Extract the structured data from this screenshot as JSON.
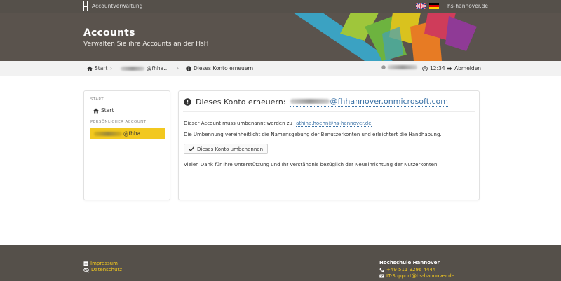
{
  "topbar": {
    "app_title": "Accountverwaltung",
    "domain": "hs-hannover.de",
    "languages": [
      {
        "code": "en",
        "icon": "uk-flag-icon"
      },
      {
        "code": "de",
        "icon": "germany-flag-icon"
      }
    ]
  },
  "hero": {
    "title": "Accounts",
    "subtitle": "Verwalten Sie ihre Accounts an der HsH"
  },
  "breadcrumb": {
    "start": "Start",
    "account_suffix": "@fhha…",
    "current": "Dieses Konto erneuern",
    "time": "12:34",
    "logout": "Abmelden"
  },
  "sidebar": {
    "section_start": "START",
    "start_label": "Start",
    "section_account": "PERSÖNLICHER ACCOUNT",
    "account_suffix": "@fhha…"
  },
  "panel": {
    "title_prefix": "Dieses Konto erneuern:",
    "title_email_suffix": "@fhhannover.onmicrosoft.com",
    "rename_text": "Dieser Account muss umbenannt werden zu",
    "rename_target": "athina.hoehn@hs-hannover.de",
    "explain_text": "Die Umbennung vereinheitlicht die Namensgebung der Benutzerkonten und erleichtert die Handhabung.",
    "button_label": "Dieses Konto umbenennen",
    "thanks_text": "Vielen Dank für Ihre Unterstützung und Ihr Verständnis bezüglich der Neueinrichtung der Nutzerkonten."
  },
  "footer": {
    "impressum": "Impressum",
    "datenschutz": "Datenschutz",
    "org": "Hochschule Hannover",
    "phone": "+49 511 9296 4444",
    "email": "IT-Support@hs-hannover.de"
  },
  "colors": {
    "header_bg": "#55504a",
    "accent_yellow": "#f2c81f",
    "link_blue": "#3d74a8"
  }
}
